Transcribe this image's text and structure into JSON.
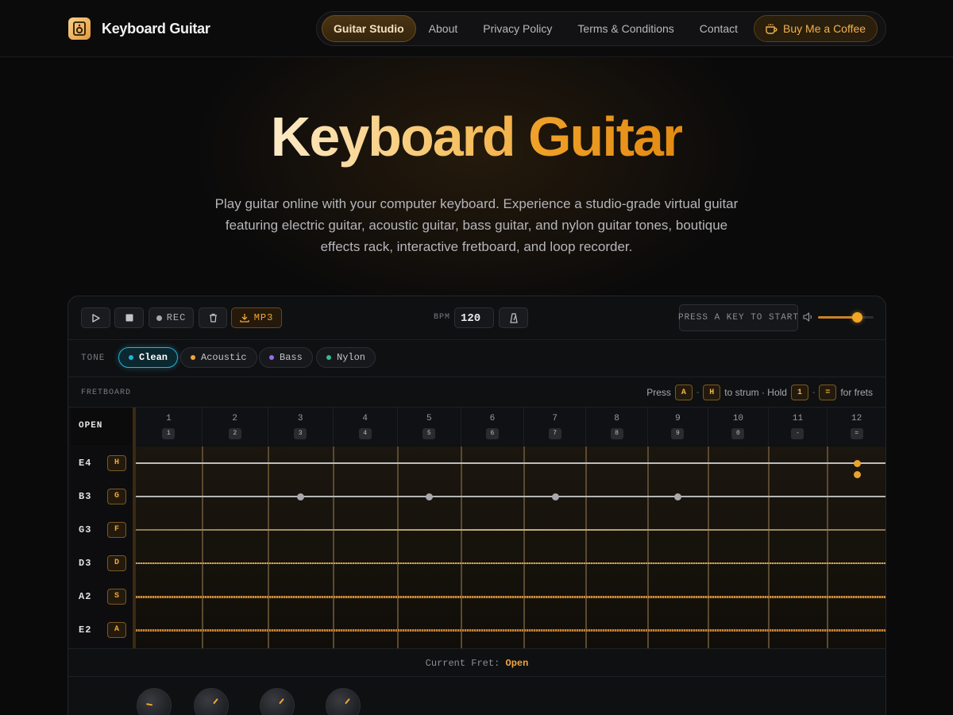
{
  "header": {
    "brand": "Keyboard Guitar",
    "nav": [
      {
        "label": "Guitar Studio",
        "active": true
      },
      {
        "label": "About"
      },
      {
        "label": "Privacy Policy"
      },
      {
        "label": "Terms & Conditions"
      },
      {
        "label": "Contact"
      }
    ],
    "coffee_label": "Buy Me a Coffee"
  },
  "hero": {
    "title_word1": "Keyboard",
    "title_word2": "Guitar",
    "description": "Play guitar online with your computer keyboard. Experience a studio-grade virtual guitar featuring electric guitar, acoustic guitar, bass guitar, and nylon guitar tones, boutique effects rack, interactive fretboard, and loop recorder."
  },
  "toolbar": {
    "rec_label": "REC",
    "mp3_label": "MP3",
    "bpm_label": "BPM",
    "bpm_value": "120",
    "status": "PRESS A KEY TO START",
    "volume": 0.7
  },
  "tone": {
    "label": "TONE",
    "options": [
      {
        "label": "Clean",
        "color": "#22b5d6",
        "active": true
      },
      {
        "label": "Acoustic",
        "color": "#f0a63a"
      },
      {
        "label": "Bass",
        "color": "#9a6cf0"
      },
      {
        "label": "Nylon",
        "color": "#2fbf8c"
      }
    ]
  },
  "fretboard": {
    "label": "FRETBOARD",
    "hint": {
      "press": "Press",
      "strum_from": "A",
      "strum_to": "H",
      "strum_text": "to strum · Hold",
      "fret_from": "1",
      "fret_to": "=",
      "fret_text": "for frets"
    },
    "open_label": "OPEN",
    "frets": [
      {
        "num": "1",
        "key": "1"
      },
      {
        "num": "2",
        "key": "2"
      },
      {
        "num": "3",
        "key": "3"
      },
      {
        "num": "4",
        "key": "4"
      },
      {
        "num": "5",
        "key": "5"
      },
      {
        "num": "6",
        "key": "6"
      },
      {
        "num": "7",
        "key": "7"
      },
      {
        "num": "8",
        "key": "8"
      },
      {
        "num": "9",
        "key": "9"
      },
      {
        "num": "10",
        "key": "0"
      },
      {
        "num": "11",
        "key": "-"
      },
      {
        "num": "12",
        "key": "="
      }
    ],
    "strings": [
      {
        "name": "E4",
        "key": "H"
      },
      {
        "name": "B3",
        "key": "G"
      },
      {
        "name": "G3",
        "key": "F"
      },
      {
        "name": "D3",
        "key": "D"
      },
      {
        "name": "A2",
        "key": "S"
      },
      {
        "name": "E2",
        "key": "A"
      }
    ]
  },
  "current_fret": {
    "label": "Current Fret:",
    "value": "Open"
  }
}
